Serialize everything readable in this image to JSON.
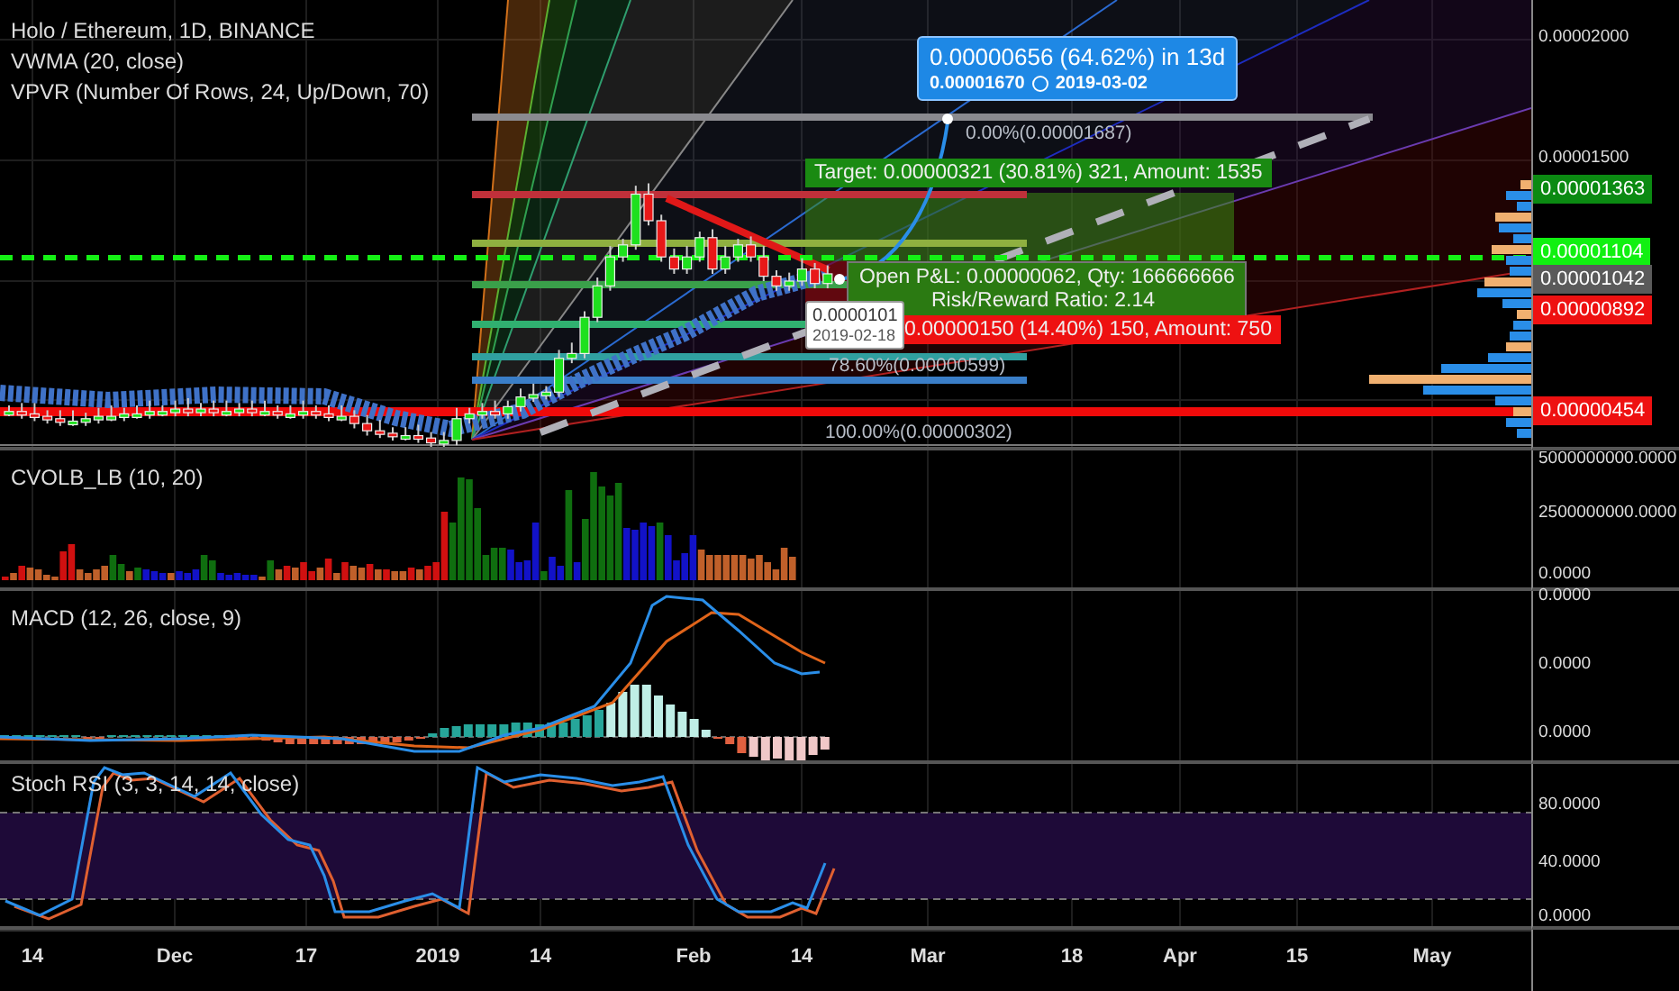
{
  "legend": {
    "symbol": "Holo / Ethereum, 1D, BINANCE",
    "indicators": [
      "VWMA (20, close)",
      "VPVR (Number Of Rows, 24, Up/Down, 70)"
    ]
  },
  "projection": {
    "change": "0.00000656 (64.62%) in 13d",
    "price": "0.00001670",
    "date": "2019-03-02"
  },
  "position": {
    "target": "Target: 0.00000321 (30.81%) 321, Amount: 1535",
    "open_pnl": "Open P&L: 0.00000062, Qty: 166666666",
    "risk_reward": "Risk/Reward Ratio: 2.14",
    "stop": "0.00000150 (14.40%) 150, Amount: 750"
  },
  "cursor_tooltip": {
    "price": "0.0000101",
    "date": "2019-02-18"
  },
  "fib_labels": [
    "0.00%(0.00001687)",
    "78.60%(0.00000599)",
    "100.00%(0.00000302)"
  ],
  "price_axis": {
    "ticks": [
      "0.00002000",
      "0.00001500"
    ],
    "badges": [
      {
        "text": "0.00001363",
        "color": "#0b8a12"
      },
      {
        "text": "0.00001104",
        "color": "#11f011"
      },
      {
        "text": "0.00001042",
        "color": "#5a5a5a"
      },
      {
        "text": "0.00000892",
        "color": "#ee1111"
      },
      {
        "text": "0.00000454",
        "color": "#ee1111"
      }
    ]
  },
  "panes": [
    {
      "kind": "volume",
      "title": "CVOLB_LB (10, 20)",
      "axis": [
        "5000000000.0000",
        "2500000000.0000",
        "0.0000"
      ]
    },
    {
      "kind": "macd",
      "title": "MACD (12, 26, close, 9)",
      "axis": [
        "0.0000",
        "0.0000",
        "0.0000"
      ]
    },
    {
      "kind": "stoch",
      "title": "Stoch RSI (3, 3, 14, 14, close)",
      "axis": [
        "80.0000",
        "40.0000",
        "0.0000"
      ]
    }
  ],
  "time_axis": [
    "14",
    "Dec",
    "17",
    "2019",
    "14",
    "Feb",
    "14",
    "Mar",
    "18",
    "Apr",
    "15",
    "May"
  ]
}
